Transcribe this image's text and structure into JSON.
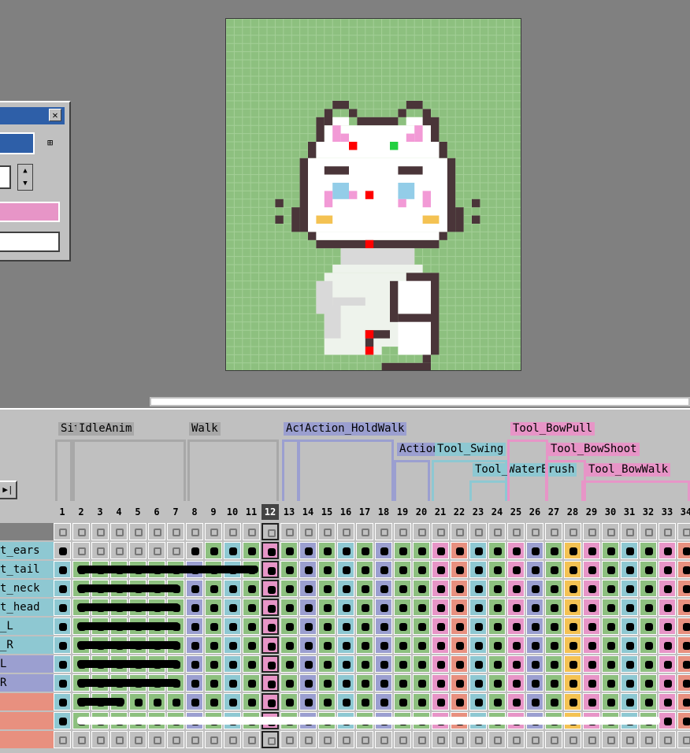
{
  "colors": {
    "workspace": "#808080",
    "sprite_bg": "#8dc07f",
    "tag_gray": "#a8a8a8",
    "tag_purple": "#9b9fd0",
    "tag_cyan": "#8ec8d2",
    "tag_pink": "#e795c7",
    "tag_salmon": "#e8907f"
  },
  "panel": {
    "close_icon": "close-icon",
    "close_glyph": "✕",
    "picker_icon": "eyedropper-icon",
    "picker_glyph": "⊞",
    "spin_up": "▲",
    "spin_down": "▼"
  },
  "timeline": {
    "play_glyph": "▶|",
    "tags": [
      {
        "label": "Sit",
        "color": "#a8a8a8"
      },
      {
        "label": "IdleAnim",
        "color": "#a8a8a8"
      },
      {
        "label": "Walk",
        "color": "#a8a8a8"
      },
      {
        "label": "Action_Hold",
        "color": "#9b9fd0"
      },
      {
        "label": "Action_HoldWalk",
        "color": "#9b9fd0"
      },
      {
        "label": "Action_Harvest",
        "color": "#9b9fd0"
      },
      {
        "label": "Tool_Swing",
        "color": "#8ec8d2"
      },
      {
        "label": "Tool_WaterBrush",
        "color": "#8ec8d2"
      },
      {
        "label": "Tool_BowPull",
        "color": "#e795c7"
      },
      {
        "label": "Tool_BowShoot",
        "color": "#e795c7"
      },
      {
        "label": "Tool_BowWalk",
        "color": "#e795c7"
      }
    ],
    "frames": [
      "1",
      "2",
      "3",
      "4",
      "5",
      "6",
      "7",
      "8",
      "9",
      "10",
      "11",
      "12",
      "13",
      "14",
      "15",
      "16",
      "17",
      "18",
      "19",
      "20",
      "21",
      "22",
      "23",
      "24",
      "25",
      "26",
      "27",
      "28",
      "29",
      "30",
      "31",
      "32",
      "33",
      "34"
    ],
    "current_frame": "12",
    "layers": [
      {
        "label": "",
        "color": "#808080"
      },
      {
        "label": "t_ears",
        "color": "#8ec8d2"
      },
      {
        "label": "t_tail",
        "color": "#8ec8d2"
      },
      {
        "label": "t_neck",
        "color": "#8ec8d2"
      },
      {
        "label": "t_head",
        "color": "#8ec8d2"
      },
      {
        "label": "_L",
        "color": "#8ec8d2"
      },
      {
        "label": "_R",
        "color": "#8ec8d2"
      },
      {
        "label": "L",
        "color": "#9b9fd0"
      },
      {
        "label": "R",
        "color": "#9b9fd0"
      },
      {
        "label": "",
        "color": "#e8907f"
      },
      {
        "label": "",
        "color": "#e8907f"
      },
      {
        "label": "",
        "color": "#e8907f"
      }
    ]
  }
}
